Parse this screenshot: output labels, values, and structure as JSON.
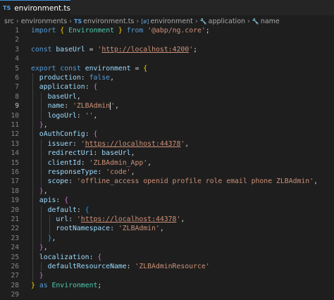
{
  "tab": {
    "icon": "typescript-icon",
    "icon_text": "TS",
    "title": "environment.ts"
  },
  "breadcrumb": {
    "items": [
      {
        "label": "src",
        "icon": ""
      },
      {
        "label": "environments",
        "icon": ""
      },
      {
        "label": "environment.ts",
        "icon": "TS"
      },
      {
        "label": "environment",
        "icon": "[ø]"
      },
      {
        "label": "application",
        "icon": "🔧"
      },
      {
        "label": "name",
        "icon": "🔧"
      }
    ]
  },
  "editor": {
    "active_line": 9,
    "lines": [
      [
        [
          "k",
          "import"
        ],
        [
          "p",
          " "
        ],
        [
          "b1",
          "{"
        ],
        [
          "p",
          " "
        ],
        [
          "ty",
          "Environment"
        ],
        [
          "p",
          " "
        ],
        [
          "b1",
          "}"
        ],
        [
          "p",
          " "
        ],
        [
          "k",
          "from"
        ],
        [
          "p",
          " "
        ],
        [
          "s",
          "'@abp/ng.core'"
        ],
        [
          "p",
          ";"
        ]
      ],
      [],
      [
        [
          "k",
          "const"
        ],
        [
          "p",
          " "
        ],
        [
          "v",
          "baseUrl"
        ],
        [
          "p",
          " = "
        ],
        [
          "s",
          "'"
        ],
        [
          "u",
          "http://localhost:4200"
        ],
        [
          "s",
          "'"
        ],
        [
          "p",
          ";"
        ]
      ],
      [],
      [
        [
          "k",
          "export"
        ],
        [
          "p",
          " "
        ],
        [
          "k",
          "const"
        ],
        [
          "p",
          " "
        ],
        [
          "v",
          "environment"
        ],
        [
          "p",
          " = "
        ],
        [
          "b1",
          "{"
        ]
      ],
      [
        [
          "p",
          "  "
        ],
        [
          "v",
          "production"
        ],
        [
          "p",
          ": "
        ],
        [
          "k",
          "false"
        ],
        [
          "p",
          ","
        ]
      ],
      [
        [
          "p",
          "  "
        ],
        [
          "v",
          "application"
        ],
        [
          "p",
          ": "
        ],
        [
          "b2",
          "{"
        ]
      ],
      [
        [
          "p",
          "    "
        ],
        [
          "v",
          "baseUrl"
        ],
        [
          "p",
          ","
        ]
      ],
      [
        [
          "p",
          "    "
        ],
        [
          "v",
          "name"
        ],
        [
          "p",
          ": "
        ],
        [
          "s",
          "'ZLBAdmin"
        ],
        [
          "cursor",
          ""
        ],
        [
          "s",
          "'"
        ],
        [
          "p",
          ","
        ]
      ],
      [
        [
          "p",
          "    "
        ],
        [
          "v",
          "logoUrl"
        ],
        [
          "p",
          ": "
        ],
        [
          "s",
          "''"
        ],
        [
          "p",
          ","
        ]
      ],
      [
        [
          "p",
          "  "
        ],
        [
          "b2",
          "}"
        ],
        [
          "p",
          ","
        ]
      ],
      [
        [
          "p",
          "  "
        ],
        [
          "v",
          "oAuthConfig"
        ],
        [
          "p",
          ": "
        ],
        [
          "b2",
          "{"
        ]
      ],
      [
        [
          "p",
          "    "
        ],
        [
          "v",
          "issuer"
        ],
        [
          "p",
          ": "
        ],
        [
          "s",
          "'"
        ],
        [
          "u",
          "https://localhost:44378"
        ],
        [
          "s",
          "'"
        ],
        [
          "p",
          ","
        ]
      ],
      [
        [
          "p",
          "    "
        ],
        [
          "v",
          "redirectUri"
        ],
        [
          "p",
          ": "
        ],
        [
          "v",
          "baseUrl"
        ],
        [
          "p",
          ","
        ]
      ],
      [
        [
          "p",
          "    "
        ],
        [
          "v",
          "clientId"
        ],
        [
          "p",
          ": "
        ],
        [
          "s",
          "'ZLBAdmin_App'"
        ],
        [
          "p",
          ","
        ]
      ],
      [
        [
          "p",
          "    "
        ],
        [
          "v",
          "responseType"
        ],
        [
          "p",
          ": "
        ],
        [
          "s",
          "'code'"
        ],
        [
          "p",
          ","
        ]
      ],
      [
        [
          "p",
          "    "
        ],
        [
          "v",
          "scope"
        ],
        [
          "p",
          ": "
        ],
        [
          "s",
          "'offline_access openid profile role email phone ZLBAdmin'"
        ],
        [
          "p",
          ","
        ]
      ],
      [
        [
          "p",
          "  "
        ],
        [
          "b2",
          "}"
        ],
        [
          "p",
          ","
        ]
      ],
      [
        [
          "p",
          "  "
        ],
        [
          "v",
          "apis"
        ],
        [
          "p",
          ": "
        ],
        [
          "b2",
          "{"
        ]
      ],
      [
        [
          "p",
          "    "
        ],
        [
          "v",
          "default"
        ],
        [
          "p",
          ": "
        ],
        [
          "b3",
          "{"
        ]
      ],
      [
        [
          "p",
          "      "
        ],
        [
          "v",
          "url"
        ],
        [
          "p",
          ": "
        ],
        [
          "s",
          "'"
        ],
        [
          "u",
          "https://localhost:44378"
        ],
        [
          "s",
          "'"
        ],
        [
          "p",
          ","
        ]
      ],
      [
        [
          "p",
          "      "
        ],
        [
          "v",
          "rootNamespace"
        ],
        [
          "p",
          ": "
        ],
        [
          "s",
          "'ZLBAdmin'"
        ],
        [
          "p",
          ","
        ]
      ],
      [
        [
          "p",
          "    "
        ],
        [
          "b3",
          "}"
        ],
        [
          "p",
          ","
        ]
      ],
      [
        [
          "p",
          "  "
        ],
        [
          "b2",
          "}"
        ],
        [
          "p",
          ","
        ]
      ],
      [
        [
          "p",
          "  "
        ],
        [
          "v",
          "localization"
        ],
        [
          "p",
          ": "
        ],
        [
          "b2",
          "{"
        ]
      ],
      [
        [
          "p",
          "    "
        ],
        [
          "v",
          "defaultResourceName"
        ],
        [
          "p",
          ": "
        ],
        [
          "s",
          "'ZLBAdminResource'"
        ]
      ],
      [
        [
          "p",
          "  "
        ],
        [
          "b2",
          "}"
        ]
      ],
      [
        [
          "b1",
          "}"
        ],
        [
          "p",
          " "
        ],
        [
          "k",
          "as"
        ],
        [
          "p",
          " "
        ],
        [
          "ty",
          "Environment"
        ],
        [
          "p",
          ";"
        ]
      ],
      []
    ]
  },
  "colors": {
    "background": "#1e1e1e",
    "keyword": "#569cd6",
    "type": "#4ec9b0",
    "variable": "#9cdcfe",
    "string": "#ce9178"
  }
}
